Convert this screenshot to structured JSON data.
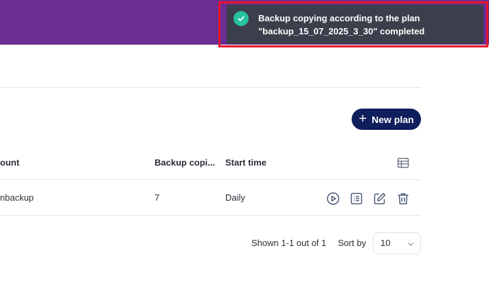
{
  "toolbar": {
    "new_plan_label": "New plan"
  },
  "table": {
    "columns": {
      "account": "ount",
      "backup_copies": "Backup copi...",
      "start_time": "Start time"
    },
    "rows": [
      {
        "account": "nbackup",
        "backup_copies": "7",
        "start_time": "Daily"
      }
    ]
  },
  "pagination": {
    "shown_text": "Shown 1-1 out of 1",
    "sort_by_label": "Sort by",
    "page_size": "10"
  },
  "notification": {
    "line1": "Backup copying according to the plan",
    "line2": "\"backup_15_07_2025_3_30\" completed"
  },
  "colors": {
    "header_bg": "#6a2d92",
    "primary_button": "#0f1e5c",
    "toast_bg": "#3a3f4b",
    "success": "#28c1a0",
    "highlight": "#e8132b"
  },
  "icons": {
    "new_plan": "plus-icon",
    "columns": "table-columns-icon",
    "row_actions": [
      "play-icon",
      "list-icon",
      "edit-icon",
      "trash-icon"
    ],
    "sort": "chevron-down-icon",
    "toast": "check-circle-icon"
  }
}
